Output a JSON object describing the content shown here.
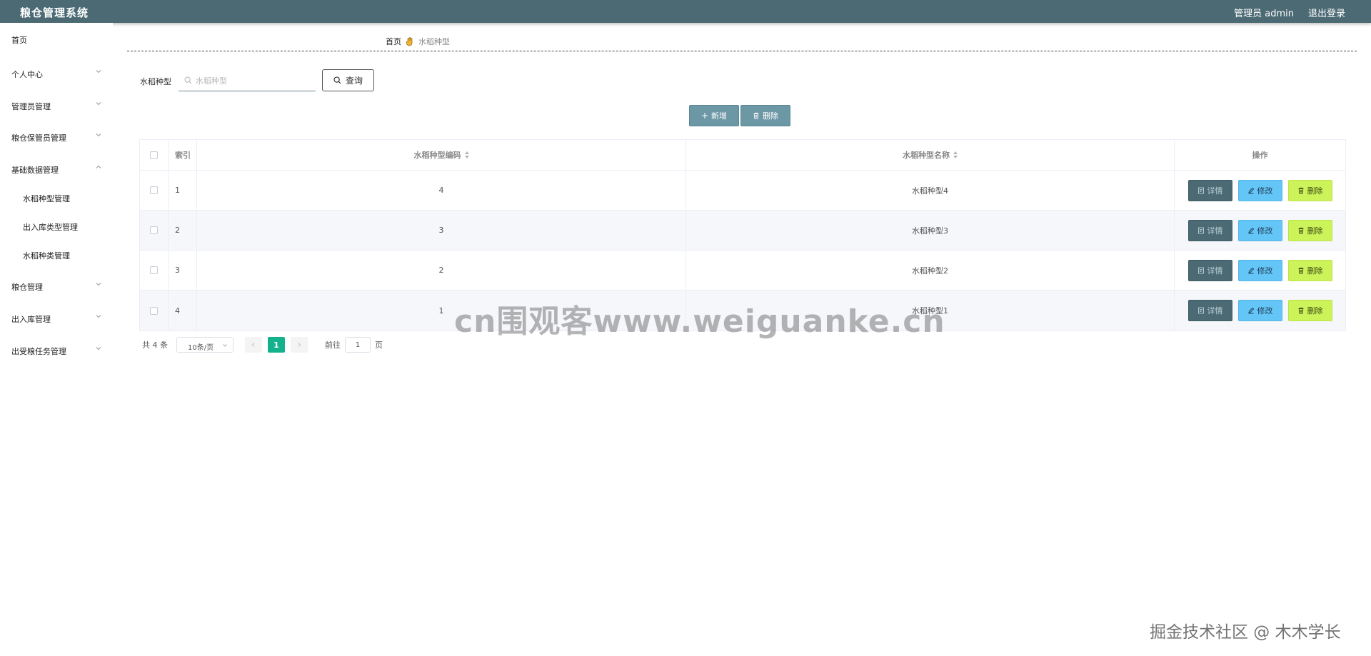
{
  "header": {
    "title": "粮仓管理系统",
    "user_label": "管理员 admin",
    "logout_label": "退出登录",
    "bg_color": "#4b6a74"
  },
  "sidebar": {
    "items": [
      {
        "label": "首页",
        "has_chevron": false
      },
      {
        "label": "个人中心",
        "has_chevron": true
      },
      {
        "label": "管理员管理",
        "has_chevron": true
      },
      {
        "label": "粮仓保管员管理",
        "has_chevron": true
      },
      {
        "label": "基础数据管理",
        "has_chevron": true,
        "expanded": true
      },
      {
        "label": "水稻种型管理",
        "sub": true
      },
      {
        "label": "出入库类型管理",
        "sub": true
      },
      {
        "label": "水稻种类管理",
        "sub": true
      },
      {
        "label": "粮仓管理",
        "has_chevron": true
      },
      {
        "label": "出入库管理",
        "has_chevron": true
      },
      {
        "label": "出受粮任务管理",
        "has_chevron": true
      }
    ]
  },
  "breadcrumb": {
    "home": "首页",
    "current": "水稻种型"
  },
  "search": {
    "label": "水稻种型",
    "placeholder": "水稻种型",
    "value": "",
    "button_label": "查询"
  },
  "actions": {
    "add_label": "新增",
    "delete_label": "删除"
  },
  "table": {
    "columns": {
      "index": "索引",
      "code": "水稻种型编码",
      "name": "水稻种型名称",
      "ops": "操作"
    },
    "rows": [
      {
        "index": "1",
        "code": "4",
        "name": "水稻种型4"
      },
      {
        "index": "2",
        "code": "3",
        "name": "水稻种型3"
      },
      {
        "index": "3",
        "code": "2",
        "name": "水稻种型2"
      },
      {
        "index": "4",
        "code": "1",
        "name": "水稻种型1"
      }
    ],
    "op_labels": {
      "detail": "详情",
      "edit": "修改",
      "delete": "删除"
    }
  },
  "pagination": {
    "total": "共 4 条",
    "page_size": "10条/页",
    "current_page": "1",
    "goto_label": "前往",
    "goto_value": "1",
    "page_suffix": "页"
  },
  "watermarks": {
    "center": "cn围观客www.weiguanke.cn",
    "corner": "掘金技术社区 @ 木木学长"
  },
  "colors": {
    "detail": "#4b6a74",
    "edit": "#64c6f6",
    "delete": "#cdf35a",
    "active_page": "#14b28c"
  }
}
